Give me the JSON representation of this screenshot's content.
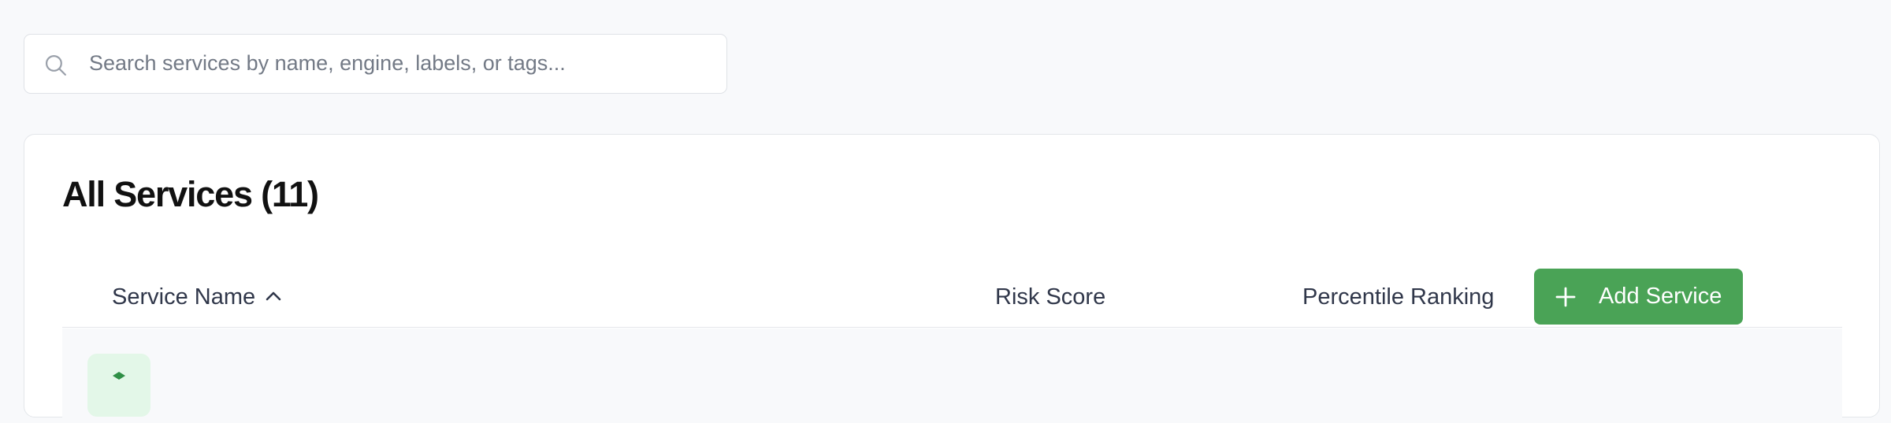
{
  "search": {
    "placeholder": "Search services by name, engine, labels, or tags...",
    "icon": "search-icon"
  },
  "services": {
    "title": "All Services (11)",
    "columns": {
      "name": "Service Name",
      "risk": "Risk Score",
      "percentile": "Percentile Ranking"
    },
    "sort": {
      "column": "name",
      "direction": "ascending",
      "icon": "chevron-up-icon"
    },
    "add_button": {
      "label": "Add Service",
      "icon": "plus-icon"
    },
    "rows": [
      {
        "icon": "service-icon"
      }
    ]
  },
  "colors": {
    "accent": "#4aa356",
    "page_background": "#f8f9fb",
    "row_icon_background": "#e3f7e8",
    "row_icon_foreground": "#2f8f46"
  }
}
